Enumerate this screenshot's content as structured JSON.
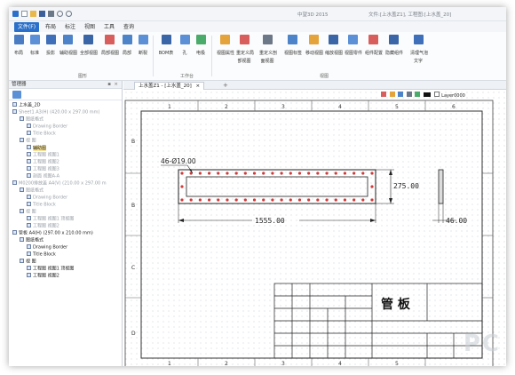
{
  "window": {
    "title": "中望3D 2015",
    "doc_info": "文件:[上水盖Z1], 工程图:[上水盖_20]"
  },
  "ribbon_tabs": [
    {
      "label": "文件(F)"
    },
    {
      "label": "布局"
    },
    {
      "label": "标注"
    },
    {
      "label": "视图"
    },
    {
      "label": "工具"
    },
    {
      "label": "查询"
    }
  ],
  "ribbon": {
    "groups": [
      {
        "label": "图形"
      },
      {
        "label": "工作台"
      },
      {
        "label": "视图"
      }
    ],
    "buttons": [
      {
        "label": "布局",
        "icon": "layout-icon"
      },
      {
        "label": "标准",
        "icon": "standard-view-icon"
      },
      {
        "label": "投影",
        "icon": "projection-icon"
      },
      {
        "label": "辅助视图",
        "icon": "aux-view-icon"
      },
      {
        "label": "全部视图",
        "icon": "all-views-icon"
      },
      {
        "label": "局部视图",
        "icon": "detail-view-icon"
      },
      {
        "label": "局部",
        "icon": "partial-icon"
      },
      {
        "label": "断裂",
        "icon": "break-icon"
      },
      {
        "label": "BOM表",
        "icon": "bom-icon"
      },
      {
        "label": "孔",
        "icon": "hole-icon"
      },
      {
        "label": "电极",
        "icon": "electrode-icon"
      },
      {
        "label": "视图属性",
        "icon": "view-props-icon"
      },
      {
        "label": "重定义局",
        "label2": "部视图",
        "icon": "redefine-local-icon"
      },
      {
        "label": "重定义剖",
        "label2": "面视图",
        "icon": "redefine-section-icon"
      },
      {
        "label": "视图标签",
        "icon": "view-label-icon"
      },
      {
        "label": "移动视图",
        "icon": "move-view-icon"
      },
      {
        "label": "缩放视图",
        "icon": "scale-view-icon"
      },
      {
        "label": "视图零件",
        "icon": "view-part-icon"
      },
      {
        "label": "组件配置",
        "icon": "assembly-config-icon"
      },
      {
        "label": "隐藏组件",
        "icon": "hide-component-icon"
      },
      {
        "label": "清理气泡",
        "label2": "文字",
        "icon": "cleanup-balloon-icon"
      }
    ]
  },
  "panel": {
    "title": "管理器",
    "tree": [
      {
        "text": "上水盖_2D",
        "level": 0,
        "style": "normal"
      },
      {
        "text": "Sheet1 A3(H) (420.00 x 297.00 mm)",
        "level": 0,
        "style": "gray"
      },
      {
        "text": "图纸格式",
        "level": 1,
        "style": "gray"
      },
      {
        "text": "Drawing Border",
        "level": 2,
        "style": "gray"
      },
      {
        "text": "Title Block",
        "level": 2,
        "style": "gray"
      },
      {
        "text": "视 图",
        "level": 1,
        "style": "gray"
      },
      {
        "text": "辅助图",
        "level": 2,
        "style": "selected"
      },
      {
        "text": "工程图 视图1",
        "level": 2,
        "style": "gray"
      },
      {
        "text": "工程图 视图2",
        "level": 2,
        "style": "gray"
      },
      {
        "text": "工程图 视图3",
        "level": 2,
        "style": "gray"
      },
      {
        "text": "剖面 视图A-A",
        "level": 2,
        "style": "gray"
      },
      {
        "text": "M0200排放盖 A4(V) (210.00 x 297.00 m",
        "level": 0,
        "style": "gray"
      },
      {
        "text": "图纸格式",
        "level": 1,
        "style": "gray"
      },
      {
        "text": "Drawing Border",
        "level": 2,
        "style": "gray"
      },
      {
        "text": "Title Block",
        "level": 2,
        "style": "gray"
      },
      {
        "text": "视 图",
        "level": 1,
        "style": "gray"
      },
      {
        "text": "工程图 视图1 顶视图",
        "level": 2,
        "style": "gray"
      },
      {
        "text": "工程图 视图2",
        "level": 2,
        "style": "gray"
      },
      {
        "text": "管板 A4(H) (297.00 x 210.00 mm)",
        "level": 0,
        "style": "normal"
      },
      {
        "text": "图纸格式",
        "level": 1,
        "style": "normal"
      },
      {
        "text": "Drawing Border",
        "level": 2,
        "style": "normal"
      },
      {
        "text": "Title Block",
        "level": 2,
        "style": "normal"
      },
      {
        "text": "视 图",
        "level": 1,
        "style": "normal"
      },
      {
        "text": "工程图 视图1 顶视图",
        "level": 2,
        "style": "normal"
      },
      {
        "text": "工程图 视图2",
        "level": 2,
        "style": "normal"
      }
    ]
  },
  "document_tab": {
    "label": "上水盖Z1 - [上水盖_20]"
  },
  "canvas_toolbar": {
    "layer": "Layer0000"
  },
  "drawing": {
    "columns": [
      "1",
      "2",
      "3",
      "4",
      "5",
      "6"
    ],
    "rows": [
      "B",
      "B",
      "C",
      "D"
    ],
    "hole_callout": "46-Ø19.00",
    "dim_length": "1555.00",
    "dim_height": "275.00",
    "dim_thickness": "46.00",
    "title_block_text": "管 板"
  },
  "watermark": "PC"
}
